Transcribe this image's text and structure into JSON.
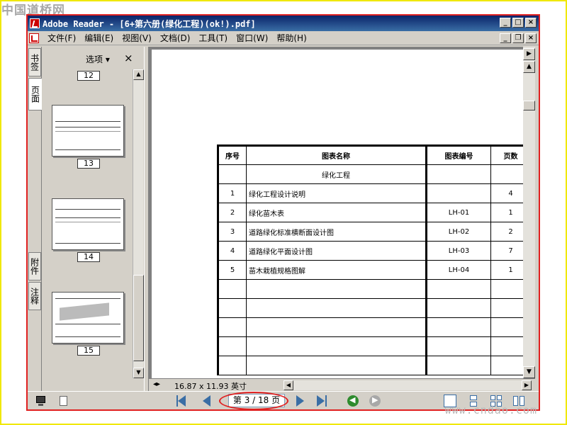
{
  "watermarks": {
    "top_left": "中国道桥网",
    "bottom_right": "www.cndao.com"
  },
  "window": {
    "title": "Adobe Reader - [6+第六册(绿化工程)(ok!).pdf]",
    "controls": [
      "_",
      "□",
      "×"
    ]
  },
  "menu": {
    "items": [
      "文件(F)",
      "编辑(E)",
      "视图(V)",
      "文档(D)",
      "工具(T)",
      "窗口(W)",
      "帮助(H)"
    ],
    "doc_controls": [
      "_",
      "❐",
      "×"
    ]
  },
  "side_tabs": {
    "bookmarks": "书签",
    "pages": "页面",
    "attachments": "附件",
    "comments": "注释"
  },
  "pages_panel": {
    "options_label": "选项 ▾",
    "close_label": "×",
    "thumbnails": [
      {
        "label": "12"
      },
      {
        "label": "13"
      },
      {
        "label": "14"
      },
      {
        "label": "15"
      }
    ]
  },
  "document": {
    "table": {
      "headers": [
        "序号",
        "图表名称",
        "图表编号",
        "页数"
      ],
      "section_title": "绿化工程",
      "rows": [
        {
          "no": "1",
          "name": "绿化工程设计说明",
          "code": "",
          "pages": "4"
        },
        {
          "no": "2",
          "name": "绿化苗木表",
          "code": "LH-01",
          "pages": "1"
        },
        {
          "no": "3",
          "name": "道路绿化标准横断面设计图",
          "code": "LH-02",
          "pages": "2"
        },
        {
          "no": "4",
          "name": "道路绿化平面设计图",
          "code": "LH-03",
          "pages": "7"
        },
        {
          "no": "5",
          "name": "苗木栽植规格图解",
          "code": "LH-04",
          "pages": "1"
        }
      ]
    }
  },
  "status": {
    "page_size": "16.87 x 11.93 英寸"
  },
  "navigation": {
    "page_indicator": "第 3 / 18 页"
  },
  "colors": {
    "annotation_red": "#e02020",
    "frame_yellow": "#f0e800",
    "nav_blue": "#3a6ea5",
    "nav_green": "#2e8b2e"
  }
}
